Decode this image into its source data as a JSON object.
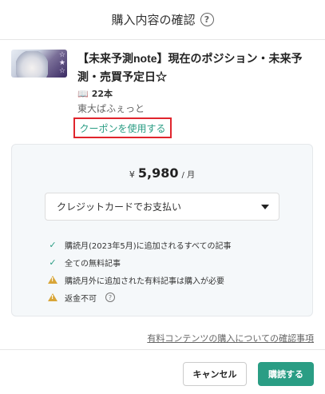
{
  "header": {
    "title": "購入内容の確認",
    "help_icon": "?"
  },
  "product": {
    "title": "【未来予測note】現在のポジション・未来予測・売買予定日☆",
    "count": "22本",
    "author": "東大ぱふぇっと",
    "coupon_link": "クーポンを使用する",
    "thumbnail_stars": "☆\n★\n☆"
  },
  "plan": {
    "currency": "¥",
    "amount": "5,980",
    "unit": "/ 月",
    "payment_method": "クレジットカードでお支払い"
  },
  "features": [
    {
      "icon": "check-icon",
      "text": "購読月(2023年5月)に追加されるすべての記事"
    },
    {
      "icon": "check-icon",
      "text": "全ての無料記事"
    },
    {
      "icon": "warning-icon",
      "text": "購読月外に追加された有料記事は購入が必要"
    },
    {
      "icon": "warning-icon",
      "text": "返金不可"
    }
  ],
  "notice_link": "有料コンテンツの購入についての確認事項",
  "footer": {
    "cancel_label": "キャンセル",
    "buy_label": "購読する"
  },
  "colors": {
    "accent": "#2a9d84",
    "highlight_box": "#e0252d",
    "warning": "#d8a538"
  }
}
